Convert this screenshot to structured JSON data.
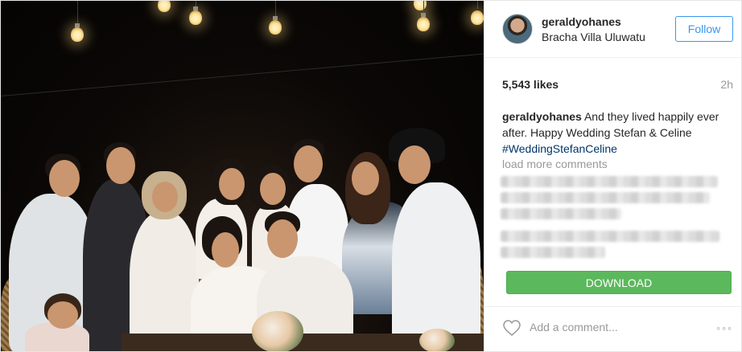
{
  "post": {
    "username": "geraldyohanes",
    "location": "Bracha Villa Uluwatu",
    "follow_label": "Follow",
    "likes": "5,543 likes",
    "time": "2h",
    "caption": {
      "user": "geraldyohanes",
      "text": " And they lived happily ever after. Happy Wedding Stefan & Celine ",
      "hashtag": "#WeddingStefanCeline"
    },
    "load_more": "load more comments",
    "download_label": "DOWNLOAD",
    "comment_placeholder": "Add a comment...",
    "more_icon": "◦◦◦"
  },
  "icons": {
    "heart": "heart-icon",
    "more": "more-options-icon"
  },
  "colors": {
    "accent": "#3897f0",
    "download": "#5cb85c",
    "hashtag": "#003569",
    "muted": "#999999"
  }
}
